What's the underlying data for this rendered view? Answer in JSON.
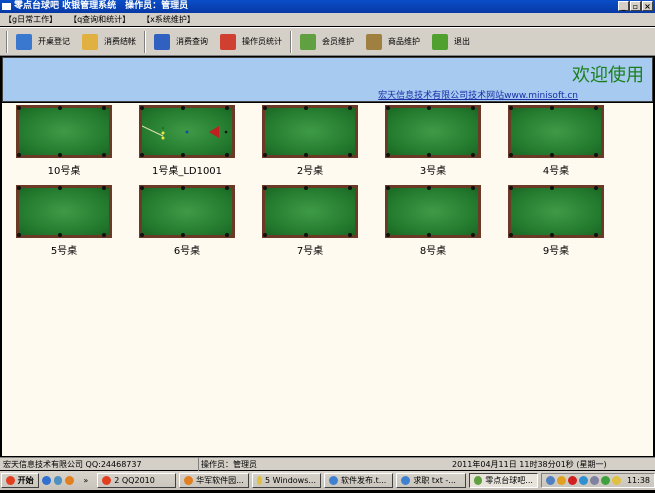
{
  "window": {
    "title": "零点台球吧 收银管理系统　操作员：管理员",
    "min": "_",
    "max": "▫",
    "close": "×"
  },
  "menu": [
    "【g日常工作】",
    "【q查询和统计】",
    "【x系统维护】"
  ],
  "toolbar": [
    {
      "label": "开桌登记",
      "icon": "open-table-icon",
      "color": "#3a78d0"
    },
    {
      "label": "消费结帐",
      "icon": "checkout-icon",
      "color": "#e0b040"
    },
    {
      "label": "消费查询",
      "icon": "search-icon",
      "color": "#3060c0"
    },
    {
      "label": "操作员统计",
      "icon": "chart-icon",
      "color": "#d04030"
    },
    {
      "label": "会员维护",
      "icon": "members-icon",
      "color": "#60a040"
    },
    {
      "label": "商品维护",
      "icon": "goods-icon",
      "color": "#a08040"
    },
    {
      "label": "退出",
      "icon": "exit-icon",
      "color": "#50a030"
    }
  ],
  "banner": {
    "welcome": "欢迎使用",
    "link": "宏天信息技术有限公司技术网站www.minisoft.cn"
  },
  "tables": [
    {
      "label": "10号桌",
      "in_use": false
    },
    {
      "label": "1号桌_LD1001",
      "in_use": true
    },
    {
      "label": "2号桌",
      "in_use": false
    },
    {
      "label": "3号桌",
      "in_use": false
    },
    {
      "label": "4号桌",
      "in_use": false
    },
    {
      "label": "5号桌",
      "in_use": false
    },
    {
      "label": "6号桌",
      "in_use": false
    },
    {
      "label": "7号桌",
      "in_use": false
    },
    {
      "label": "8号桌",
      "in_use": false
    },
    {
      "label": "9号桌",
      "in_use": false
    }
  ],
  "status": {
    "company": "宏天信息技术有限公司 QQ:24468737",
    "operator": "操作员：管理员",
    "datetime": "2011年04月11日 11时38分01秒 (星期一)"
  },
  "taskbar": {
    "start": "开始",
    "more": "»",
    "tasks": [
      "2 QQ2010",
      "华军软件园...",
      "5 Windows...",
      "软件发布.t...",
      "求职 txt -...",
      "零点台球吧..."
    ],
    "clock": "11:38"
  }
}
